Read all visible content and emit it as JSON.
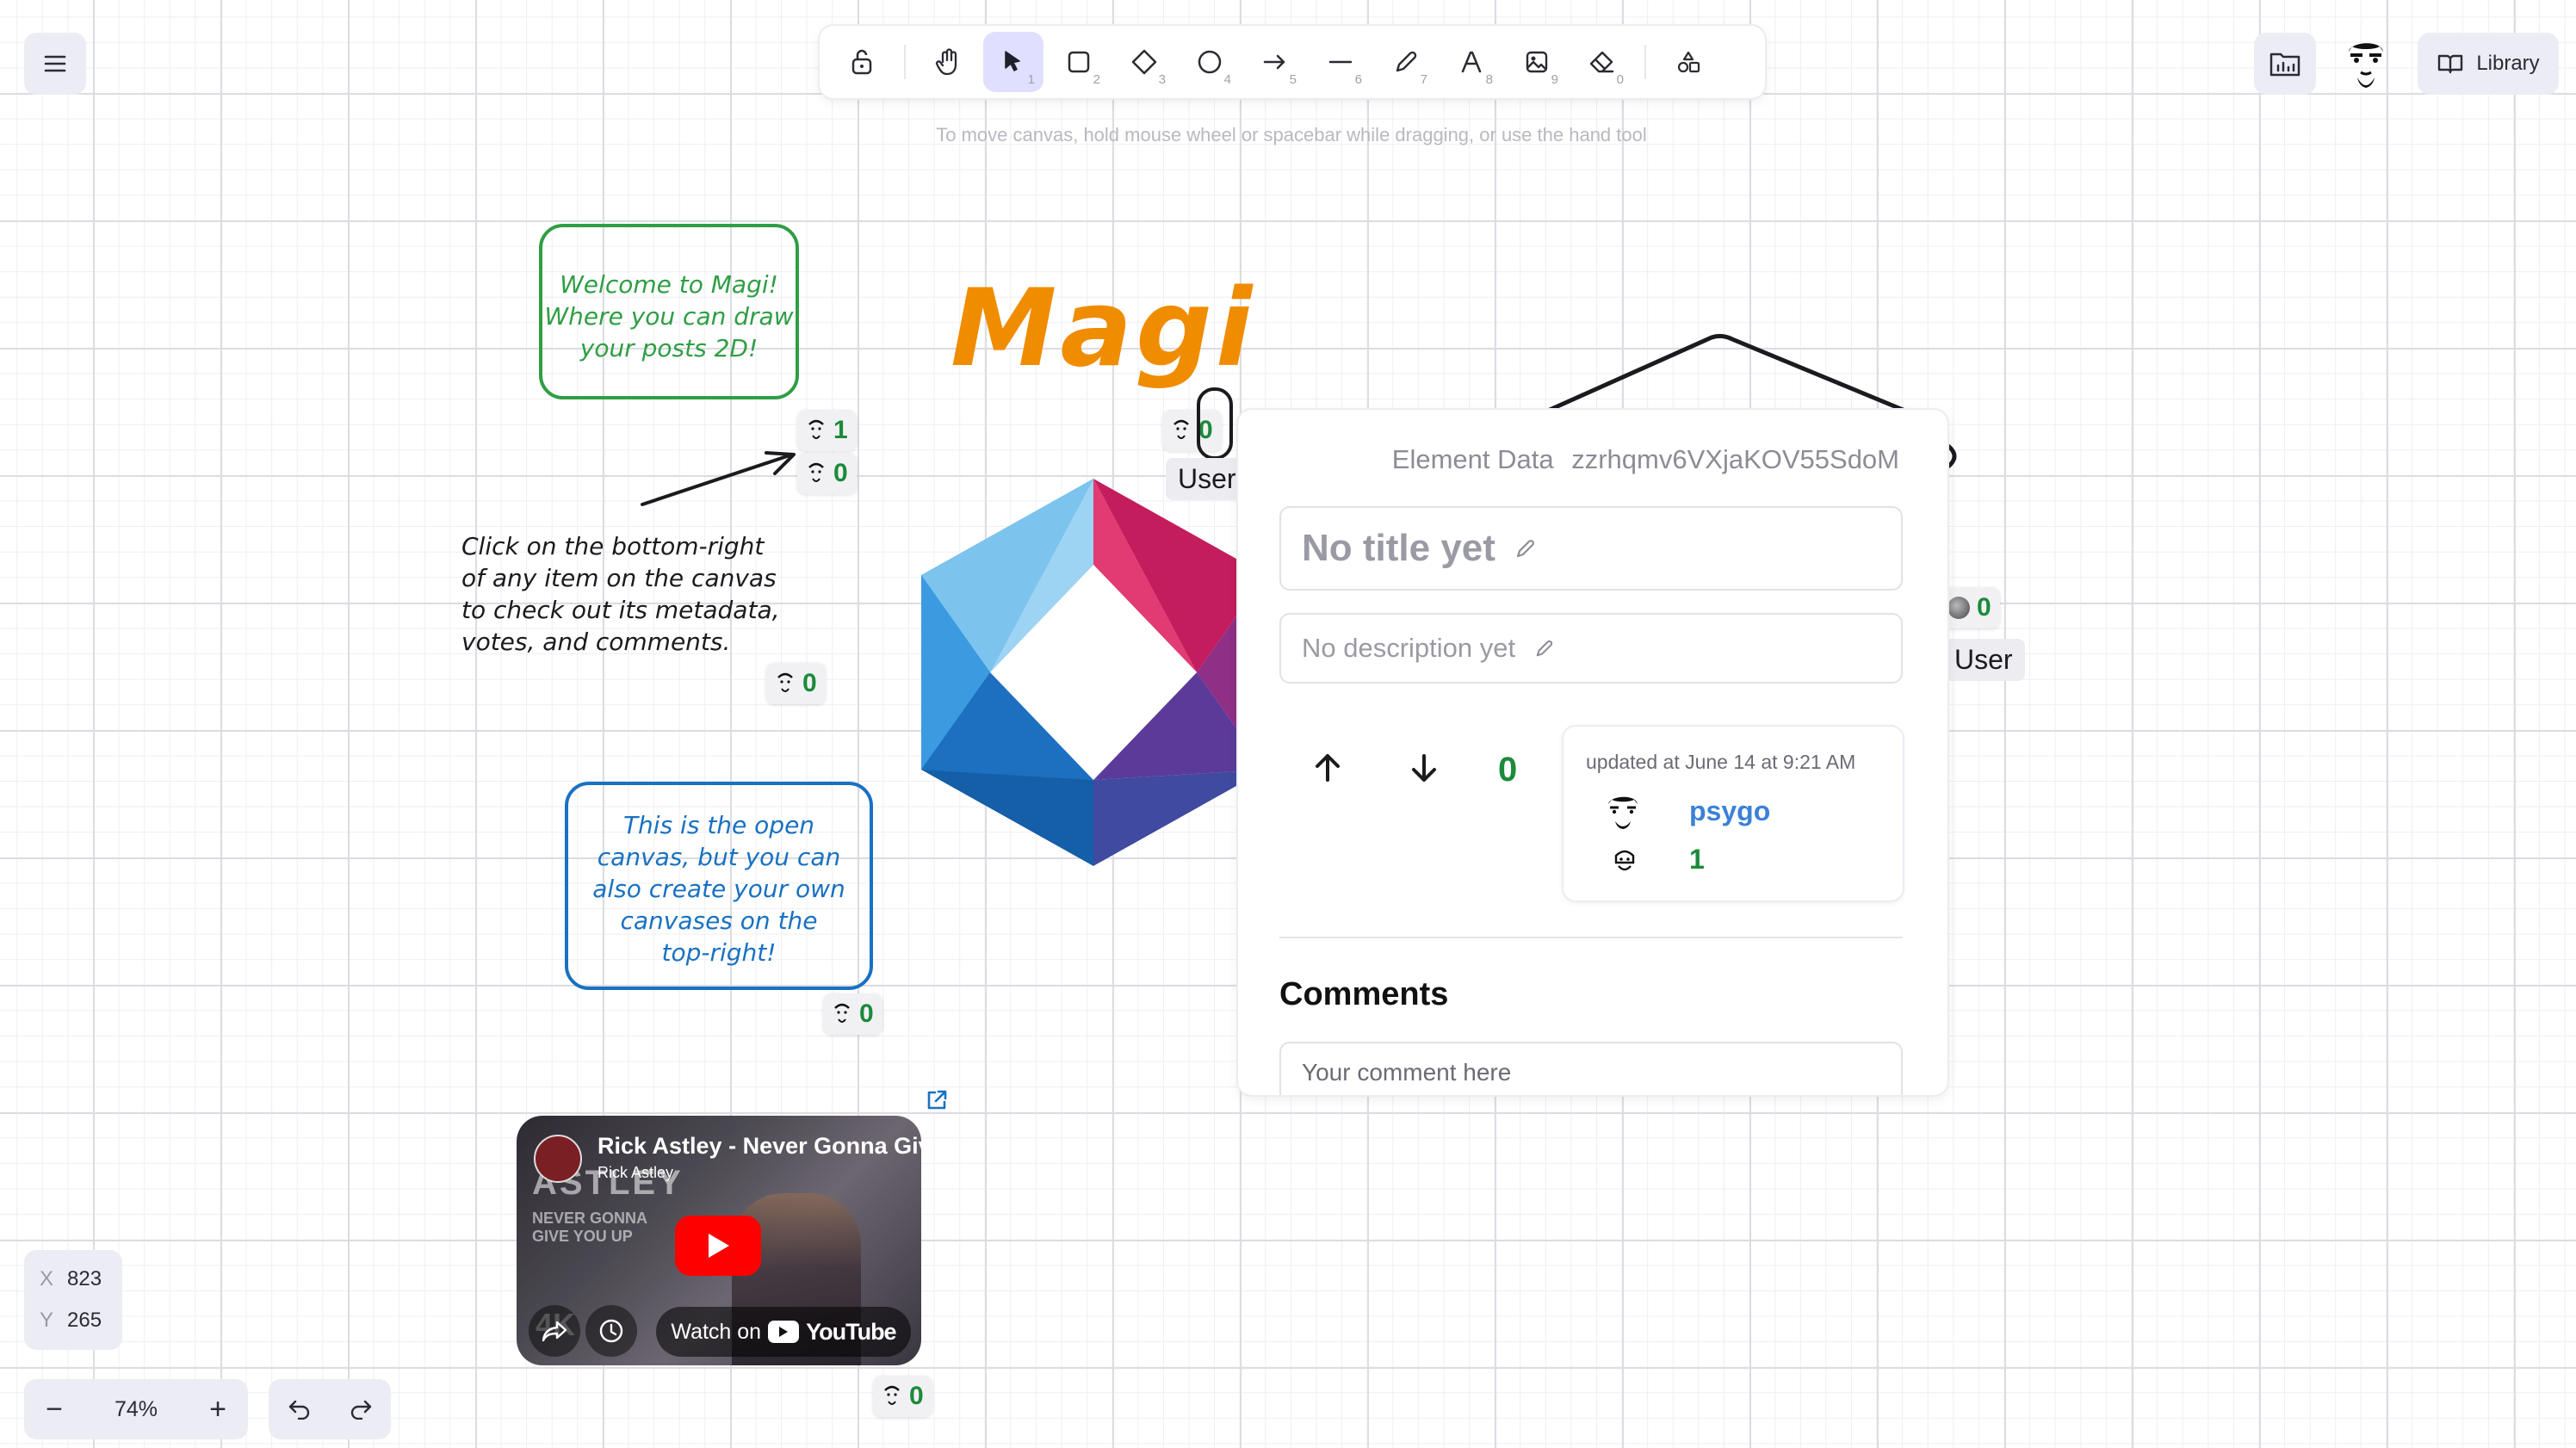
{
  "toolbar": {
    "tools": [
      {
        "name": "lock",
        "key": ""
      },
      {
        "name": "hand",
        "key": ""
      },
      {
        "name": "selection",
        "key": "1"
      },
      {
        "name": "rectangle",
        "key": "2"
      },
      {
        "name": "diamond",
        "key": "3"
      },
      {
        "name": "ellipse",
        "key": "4"
      },
      {
        "name": "arrow",
        "key": "5"
      },
      {
        "name": "line",
        "key": "6"
      },
      {
        "name": "draw",
        "key": "7"
      },
      {
        "name": "text",
        "key": "8"
      },
      {
        "name": "image",
        "key": "9"
      },
      {
        "name": "eraser",
        "key": "0"
      }
    ],
    "hint": "To move canvas, hold mouse wheel or spacebar while dragging, or use the hand tool"
  },
  "library_label": "Library",
  "canvas": {
    "welcome_note": [
      "Welcome to Magi!",
      "Where you can draw",
      "your posts 2D!"
    ],
    "magi_title": "Magi",
    "instructions": [
      "Click on the bottom-right",
      "of any item on the canvas",
      "to check out its metadata,",
      "votes, and comments."
    ],
    "open_canvas_note": [
      "This is the open",
      "canvas, but you can",
      "also create your own",
      "canvases on the",
      "top-right!"
    ],
    "badges": {
      "welcome_a": "1",
      "welcome_b": "0",
      "instructions": "0",
      "magi": "0",
      "open_canvas": "0",
      "video": "0",
      "right": "0"
    },
    "user_label_1": "User",
    "user_label_2": "User",
    "video": {
      "title": "Rick Astley - Never Gonna Giv",
      "channel": "Rick Astley",
      "watch_on": "Watch on",
      "brand": "YouTube",
      "quality": "4K",
      "thumb_text": [
        "ASTLEY",
        "NEVER GONNA",
        "GIVE YOU UP"
      ]
    }
  },
  "panel": {
    "header_label": "Element Data",
    "element_id": "zzrhqmv6VXjaKOV55SdoM",
    "title_placeholder": "No title yet",
    "description_placeholder": "No description yet",
    "vote_count": "0",
    "updated": "updated at June 14 at 9:21 AM",
    "author": "psygo",
    "author_votes": "1",
    "comments_heading": "Comments",
    "comment_placeholder": "Your comment here"
  },
  "coords": {
    "x_label": "X",
    "x": "823",
    "y_label": "Y",
    "y": "265"
  },
  "zoom": {
    "value": "74%",
    "minus": "−",
    "plus": "+"
  },
  "colors": {
    "accent": "#6965db",
    "active_tool_bg": "#e0dfff",
    "green_note": "#2f9e44",
    "blue_note": "#1971c2",
    "magi_orange": "#f08c00",
    "count_green": "#1c8a3a",
    "author_blue": "#3b82d6"
  }
}
